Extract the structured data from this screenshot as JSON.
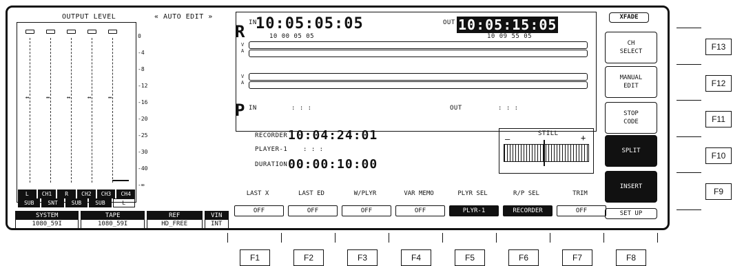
{
  "output_level": {
    "title": "OUTPUT LEVEL",
    "scale": [
      "0",
      "-4",
      "-8",
      "-12",
      "-16",
      "-20",
      "-25",
      "-30",
      "-40",
      "-∞"
    ],
    "channels": [
      {
        "label": "L",
        "active": true
      },
      {
        "label": "CH1",
        "active": true
      },
      {
        "label": "R",
        "active": true
      },
      {
        "label": "CH2",
        "active": true
      },
      {
        "label": "CH3",
        "active": true
      },
      {
        "label": "CH4",
        "active": true
      }
    ],
    "channels_row2": [
      {
        "label": "SUB",
        "active": true
      },
      {
        "label": "SNT",
        "active": true
      },
      {
        "label": "SUB",
        "active": true
      },
      {
        "label": "SUB",
        "active": true
      },
      {
        "label": "L",
        "active": false
      }
    ]
  },
  "auto_edit": "« AUTO EDIT »",
  "recorder_panel": {
    "r_letter": "R",
    "p_letter": "P",
    "in_label": "IN",
    "out_label": "OUT",
    "in_time": "10:05:05:05",
    "out_time": "10:05:15:05",
    "in_sub": "10 00 05 05",
    "out_sub": "10 09 55 05",
    "p_in_label": "IN",
    "p_out_label": "OUT",
    "p_in_time": ":   :   :",
    "p_out_time": ":   :   :",
    "v_label": "V",
    "a_label": "A"
  },
  "status": {
    "recorder_label": "RECORDER",
    "recorder_time": "10:04:24:01",
    "player_label": "PLAYER-1",
    "player_time": ":   :   :",
    "duration_label": "DURATION",
    "duration_time": "00:00:10:00"
  },
  "still": {
    "label": "STILL",
    "minus": "–",
    "plus": "+"
  },
  "xfade": "XFADE",
  "right_buttons": [
    {
      "label": "CH\nSELECT",
      "dark": false
    },
    {
      "label": "MANUAL\nEDIT",
      "dark": false
    },
    {
      "label": "STOP\nCODE",
      "dark": false
    },
    {
      "label": "SPLIT",
      "dark": true
    },
    {
      "label": "INSERT",
      "dark": true
    },
    {
      "label": "SET UP",
      "dark": false
    }
  ],
  "system_boxes": [
    {
      "head": "SYSTEM",
      "value": "1080_59I"
    },
    {
      "head": "TAPE",
      "value": "1080_59I"
    },
    {
      "head": "REF",
      "value": "HD_FREE"
    },
    {
      "head": "VIN",
      "value": "INT"
    }
  ],
  "function_row": [
    {
      "head": "LAST X",
      "value": "OFF",
      "active": false
    },
    {
      "head": "LAST ED",
      "value": "OFF",
      "active": false
    },
    {
      "head": "W/PLYR",
      "value": "OFF",
      "active": false
    },
    {
      "head": "VAR MEMO",
      "value": "OFF",
      "active": false
    },
    {
      "head": "PLYR SEL",
      "value": "PLYR-1",
      "active": true
    },
    {
      "head": "R/P SEL",
      "value": "RECORDER",
      "active": true
    },
    {
      "head": "TRIM",
      "value": "OFF",
      "active": false
    }
  ],
  "bottom_keys": [
    "F1",
    "F2",
    "F3",
    "F4",
    "F5",
    "F6",
    "F7",
    "F8"
  ],
  "side_keys": [
    "F13",
    "F12",
    "F11",
    "F10",
    "F9"
  ]
}
